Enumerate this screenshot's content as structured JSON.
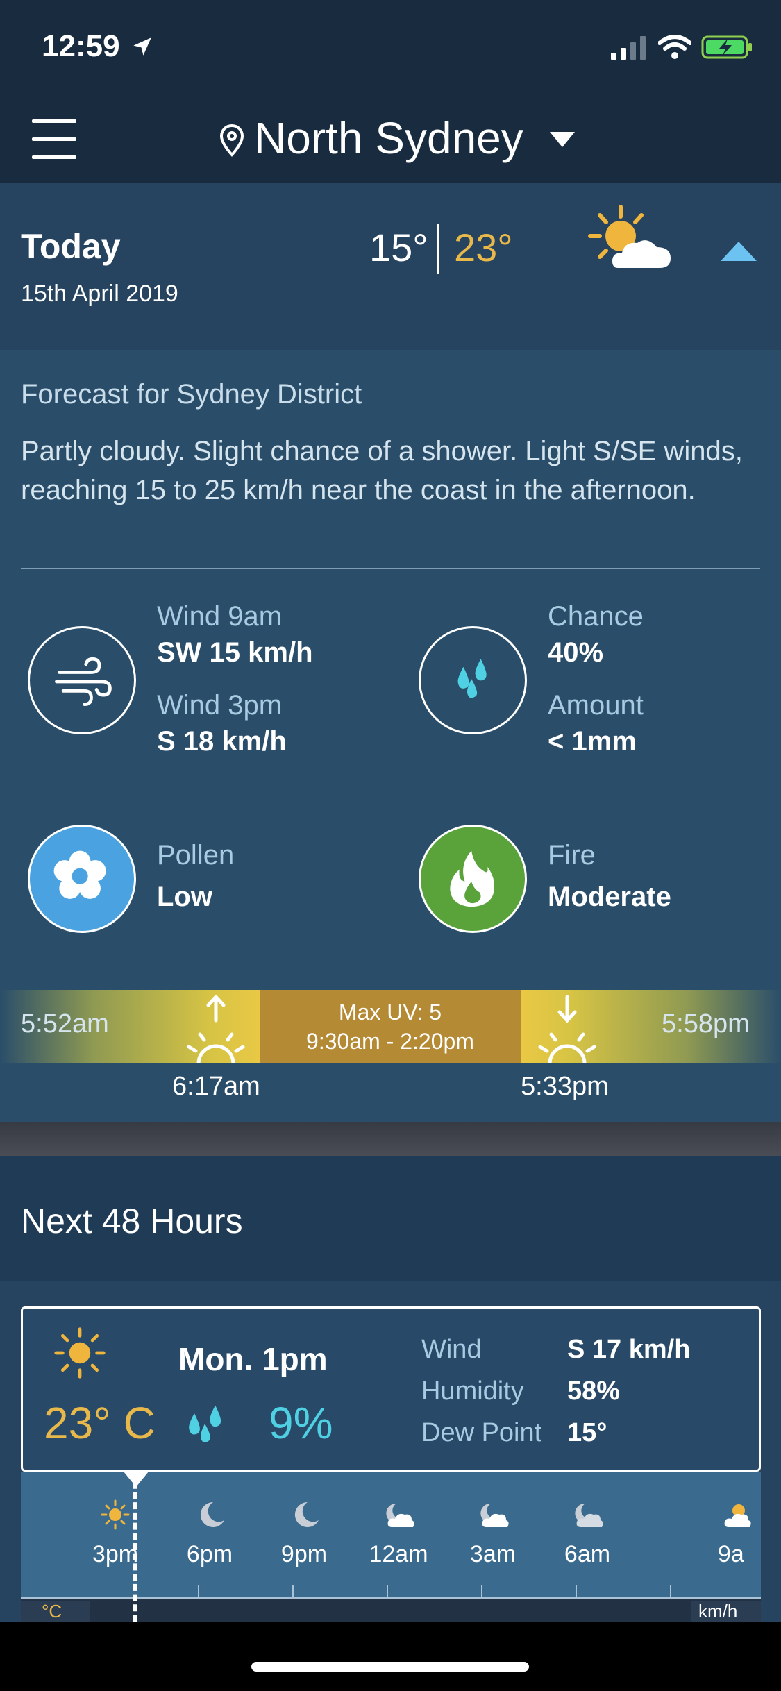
{
  "status_bar": {
    "time": "12:59"
  },
  "header": {
    "location": "North Sydney"
  },
  "today": {
    "label": "Today",
    "date": "15th April 2019",
    "min_temp": "15°",
    "max_temp": "23°"
  },
  "forecast": {
    "heading": "Forecast for Sydney District",
    "text": "Partly cloudy. Slight chance of a shower. Light S/SE winds, reaching 15 to 25 km/h near the coast in the afternoon."
  },
  "wind": {
    "label_9am": "Wind 9am",
    "value_9am": "SW 15 km/h",
    "label_3pm": "Wind 3pm",
    "value_3pm": "S 18 km/h"
  },
  "rain": {
    "chance_label": "Chance",
    "chance_value": "40%",
    "amount_label": "Amount",
    "amount_value": "< 1mm"
  },
  "pollen": {
    "label": "Pollen",
    "value": "Low"
  },
  "fire": {
    "label": "Fire",
    "value": "Moderate"
  },
  "sun": {
    "first_light": "5:52am",
    "sunrise": "6:17am",
    "uv_max": "Max UV: 5",
    "uv_window": "9:30am - 2:20pm",
    "sunset": "5:33pm",
    "last_light": "5:58pm"
  },
  "next48": {
    "title": "Next 48 Hours",
    "card": {
      "temp": "23° C",
      "time": "Mon. 1pm",
      "rain_chance": "9%",
      "wind_label": "Wind",
      "wind_value": "S 17 km/h",
      "humidity_label": "Humidity",
      "humidity_value": "58%",
      "dew_label": "Dew Point",
      "dew_value": "15°"
    },
    "timeline": [
      {
        "time": "3pm",
        "icon": "sun-icon"
      },
      {
        "time": "6pm",
        "icon": "moon-icon"
      },
      {
        "time": "9pm",
        "icon": "moon-icon"
      },
      {
        "time": "12am",
        "icon": "moon-cloud-icon"
      },
      {
        "time": "3am",
        "icon": "moon-cloud-icon"
      },
      {
        "time": "6am",
        "icon": "moon-cloud-icon"
      },
      {
        "time": "9a",
        "icon": "sun-cloud-icon"
      }
    ],
    "unit_left": "°C",
    "unit_right": "km/h"
  },
  "colors": {
    "background": "#1c3147",
    "max_temp": "#e8b84a",
    "rain": "#4fd1e3",
    "pollen": "#4aa3e0",
    "fire": "#5aa33a",
    "uv": "#b48a35"
  }
}
